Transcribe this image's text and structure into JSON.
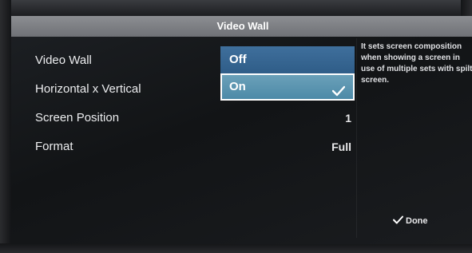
{
  "title": "Video Wall",
  "menu": {
    "items": [
      {
        "label": "Video Wall"
      },
      {
        "label": "Horizontal x Vertical"
      },
      {
        "label": "Screen Position",
        "value": "1"
      },
      {
        "label": "Format",
        "value": "Full"
      }
    ]
  },
  "dropdown": {
    "options": [
      {
        "label": "Off",
        "selected": false
      },
      {
        "label": "On",
        "selected": true
      }
    ]
  },
  "help": {
    "text": "It sets screen composition when showing a screen in use of multiple sets with spilt screen."
  },
  "footer": {
    "done_label": "Done"
  },
  "colors": {
    "title_bar": "#7d7f84",
    "option_off": "#3a6893",
    "option_on": "#5c95b0",
    "text": "#ecedef"
  },
  "icons": {
    "checkmark": "check-icon",
    "done": "check-icon"
  }
}
